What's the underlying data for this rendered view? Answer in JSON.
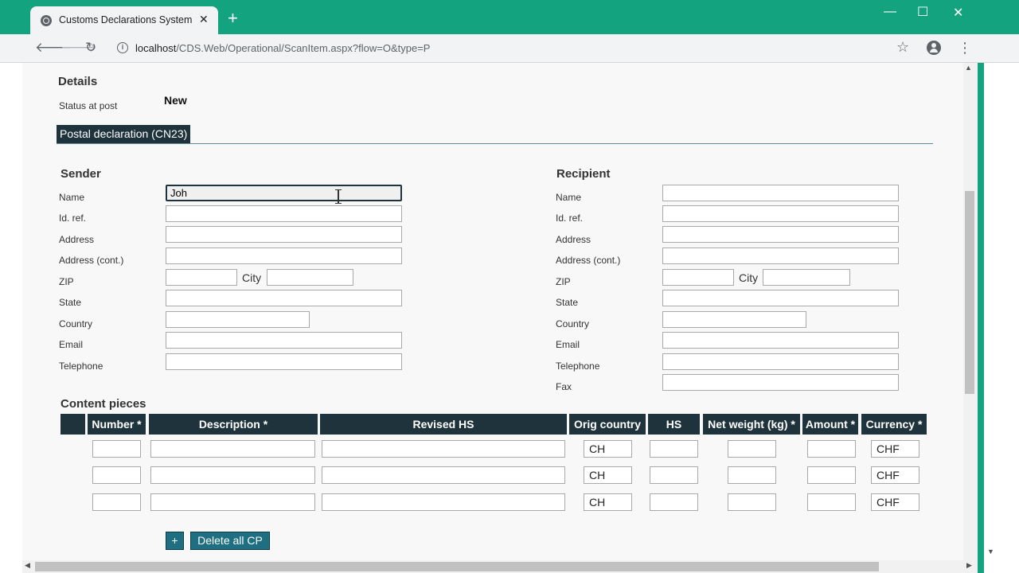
{
  "browser": {
    "tab_title": "Customs Declarations System",
    "url_host": "localhost",
    "url_path": "/CDS.Web/Operational/ScanItem.aspx?flow=O&type=P"
  },
  "details": {
    "title": "Details",
    "status_label": "Status at post",
    "status_value": "New"
  },
  "section": {
    "label": "Postal declaration (CN23)"
  },
  "sender": {
    "title": "Sender",
    "labels": {
      "name": "Name",
      "id_ref": "Id. ref.",
      "address": "Address",
      "address_cont": "Address (cont.)",
      "zip": "ZIP",
      "city": "City",
      "state": "State",
      "country": "Country",
      "email": "Email",
      "telephone": "Telephone"
    },
    "values": {
      "name": "Joh"
    }
  },
  "recipient": {
    "title": "Recipient",
    "labels": {
      "name": "Name",
      "id_ref": "Id. ref.",
      "address": "Address",
      "address_cont": "Address (cont.)",
      "zip": "ZIP",
      "city": "City",
      "state": "State",
      "country": "Country",
      "email": "Email",
      "telephone": "Telephone",
      "fax": "Fax"
    }
  },
  "content_pieces": {
    "title": "Content pieces",
    "columns": [
      "Number *",
      "Description *",
      "Revised HS",
      "Orig country",
      "HS",
      "Net weight (kg) *",
      "Amount *",
      "Currency *"
    ],
    "rows": [
      {
        "orig_country": "CH",
        "currency": "CHF"
      },
      {
        "orig_country": "CH",
        "currency": "CHF"
      },
      {
        "orig_country": "CH",
        "currency": "CHF"
      }
    ],
    "add_label": "+",
    "delete_label": "Delete all  CP"
  },
  "colors": {
    "accent": "#14a37f",
    "header_dark": "#1f333d",
    "button": "#1f6f83"
  }
}
